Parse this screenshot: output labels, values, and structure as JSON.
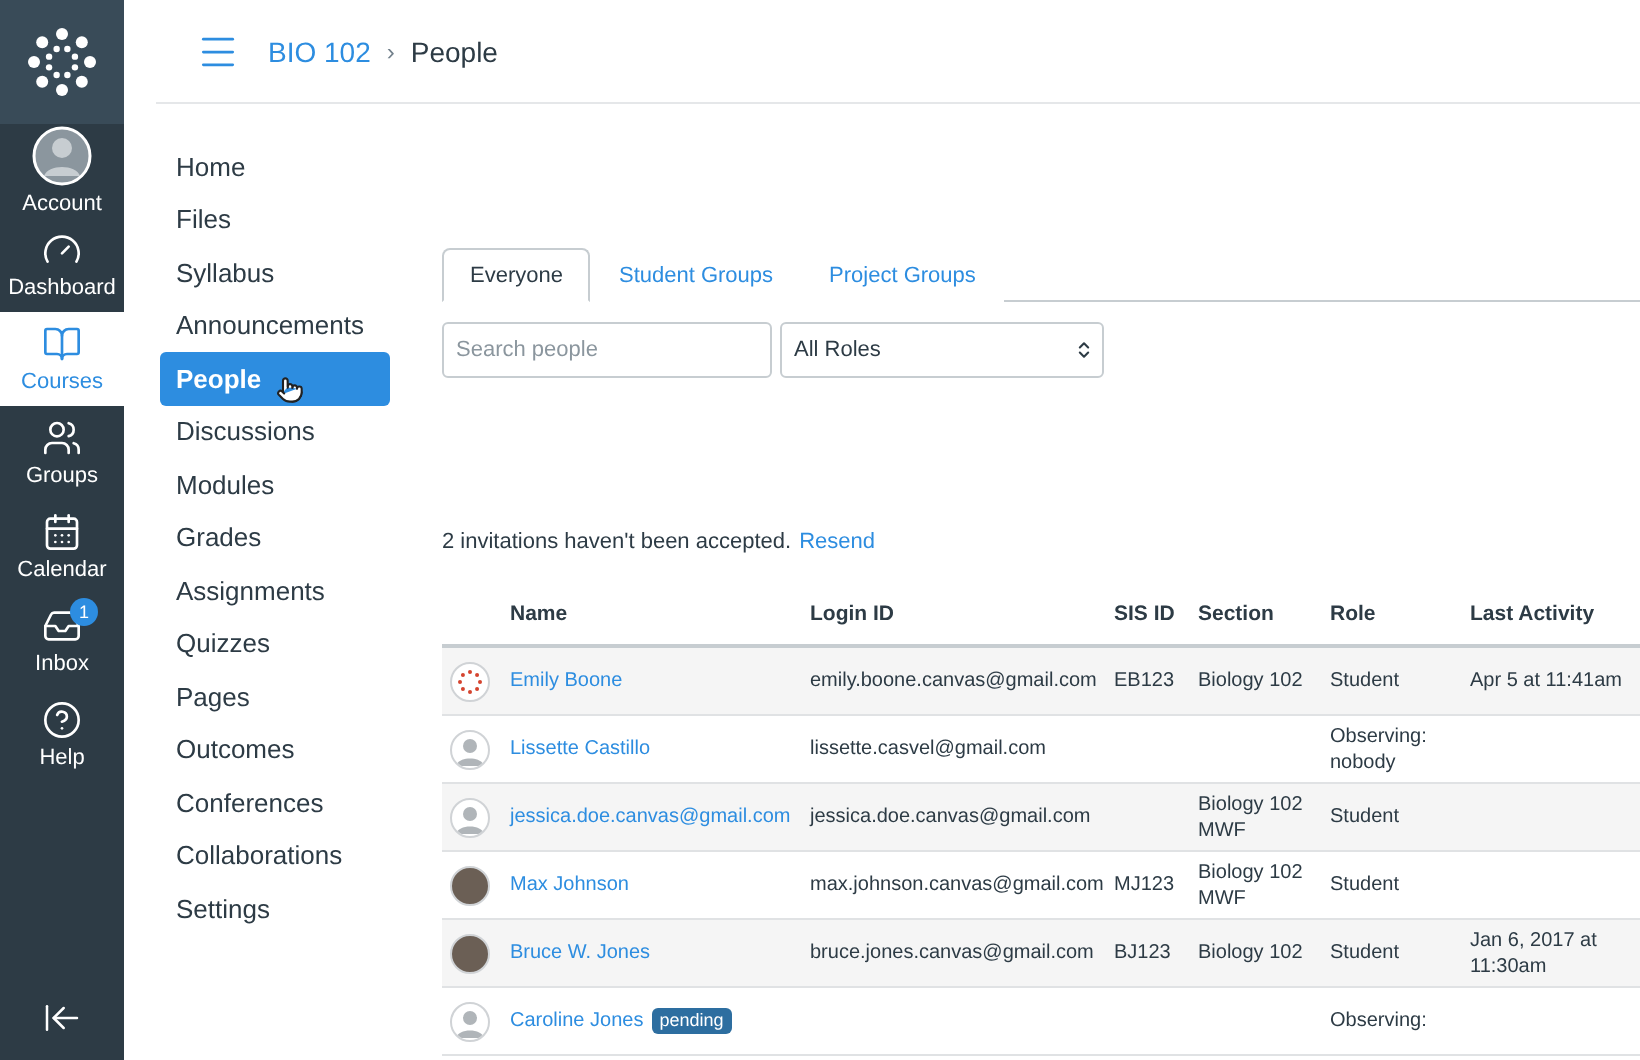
{
  "global_nav": [
    {
      "kind": "account",
      "label": "Account",
      "selected": false
    },
    {
      "kind": "dashboard",
      "label": "Dashboard",
      "selected": false
    },
    {
      "kind": "courses",
      "label": "Courses",
      "selected": true
    },
    {
      "kind": "groups",
      "label": "Groups",
      "selected": false
    },
    {
      "kind": "calendar",
      "label": "Calendar",
      "selected": false
    },
    {
      "kind": "inbox",
      "label": "Inbox",
      "selected": false,
      "badge": "1"
    },
    {
      "kind": "help",
      "label": "Help",
      "selected": false
    }
  ],
  "breadcrumb": {
    "course": "BIO 102",
    "separator": "›",
    "page": "People"
  },
  "course_nav": [
    {
      "label": "Home",
      "selected": false
    },
    {
      "label": "Files",
      "selected": false
    },
    {
      "label": "Syllabus",
      "selected": false
    },
    {
      "label": "Announcements",
      "selected": false
    },
    {
      "label": "People",
      "selected": true
    },
    {
      "label": "Discussions",
      "selected": false
    },
    {
      "label": "Modules",
      "selected": false
    },
    {
      "label": "Grades",
      "selected": false
    },
    {
      "label": "Assignments",
      "selected": false
    },
    {
      "label": "Quizzes",
      "selected": false
    },
    {
      "label": "Pages",
      "selected": false
    },
    {
      "label": "Outcomes",
      "selected": false
    },
    {
      "label": "Conferences",
      "selected": false
    },
    {
      "label": "Collaborations",
      "selected": false
    },
    {
      "label": "Settings",
      "selected": false
    }
  ],
  "tabs": [
    {
      "label": "Everyone",
      "selected": true
    },
    {
      "label": "Student Groups",
      "selected": false
    },
    {
      "label": "Project Groups",
      "selected": false
    }
  ],
  "search": {
    "placeholder": "Search people"
  },
  "role_filter": {
    "value": "All Roles"
  },
  "invitations": {
    "text": "2 invitations haven't been accepted.",
    "link": "Resend"
  },
  "table": {
    "columns": [
      "Name",
      "Login ID",
      "SIS ID",
      "Section",
      "Role",
      "Last Activity"
    ],
    "rows": [
      {
        "avatar": {
          "kind": "logo"
        },
        "name": "Emily Boone",
        "login_id": "emily.boone.canvas@gmail.com",
        "sis_id": "EB123",
        "section": "Biology 102",
        "role": "Student",
        "last_activity": "Apr 5 at 11:41am"
      },
      {
        "avatar": {
          "kind": "default"
        },
        "name": "Lissette Castillo",
        "login_id": "lissette.casvel@gmail.com",
        "role": "Observing: nobody"
      },
      {
        "avatar": {
          "kind": "default"
        },
        "name": "jessica.doe.canvas@gmail.com",
        "login_id": "jessica.doe.canvas@gmail.com",
        "section": "Biology 102 MWF",
        "role": "Student"
      },
      {
        "avatar": {
          "kind": "photo"
        },
        "name": "Max Johnson",
        "login_id": "max.johnson.canvas@gmail.com",
        "sis_id": "MJ123",
        "section": "Biology 102 MWF",
        "role": "Student"
      },
      {
        "avatar": {
          "kind": "photo"
        },
        "name": "Bruce W. Jones",
        "login_id": "bruce.jones.canvas@gmail.com",
        "sis_id": "BJ123",
        "section": "Biology 102",
        "role": "Student",
        "last_activity": "Jan 6, 2017 at 11:30am"
      },
      {
        "avatar": {
          "kind": "default"
        },
        "name": "Caroline Jones",
        "badge": "pending",
        "role": "Observing:"
      }
    ]
  }
}
